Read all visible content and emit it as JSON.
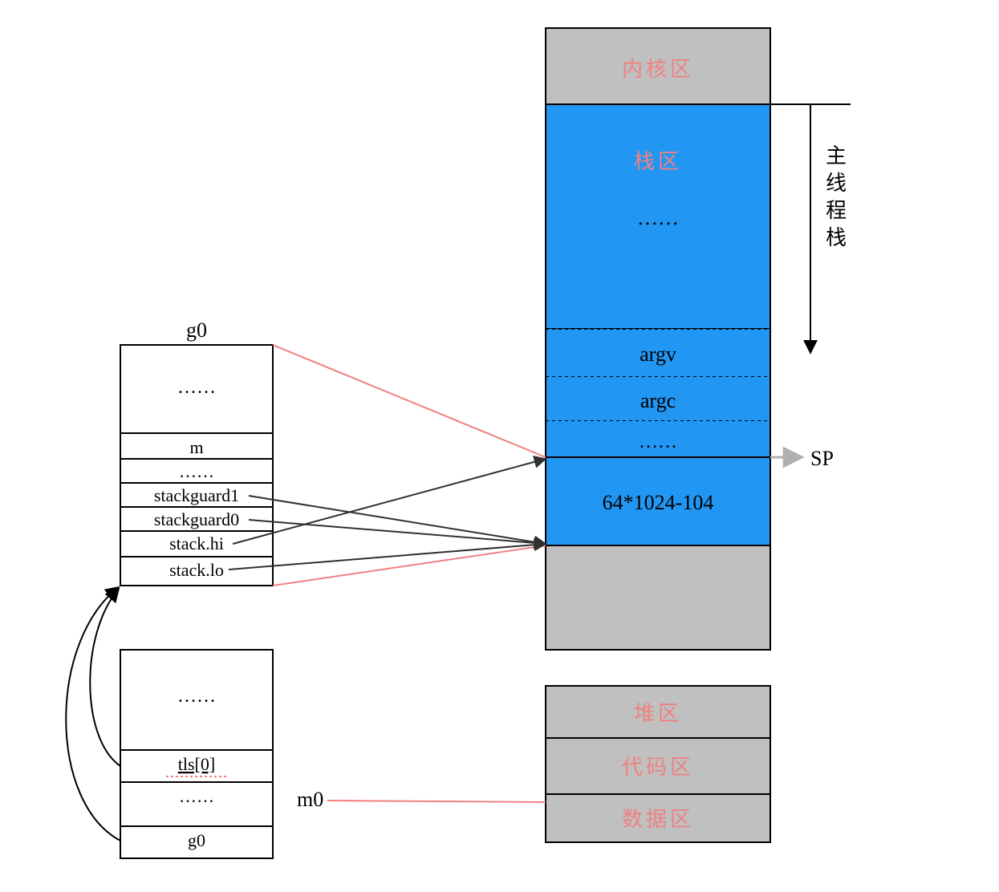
{
  "g0": {
    "title": "g0",
    "rows": [
      "……",
      "m",
      "……",
      "stackguard1",
      "stackguard0",
      "stack.hi",
      "stack.lo"
    ]
  },
  "m0": {
    "title": "m0",
    "rows": [
      "……",
      "tls[0]",
      "……",
      "g0"
    ]
  },
  "memory": {
    "kernel": "内核区",
    "stack": "栈区",
    "stack_dots": "……",
    "argv": "argv",
    "argc": "argc",
    "row_dots": "……",
    "size": "64*1024-104",
    "heap": "堆区",
    "code": "代码区",
    "data": "数据区"
  },
  "labels": {
    "sp": "SP",
    "main_stack": "主线程栈"
  },
  "colors": {
    "gray": "#c0c0c0",
    "blue": "#2196f3",
    "red": "#f08080",
    "black": "#000000",
    "dark": "#303030",
    "lightgray": "#b0b0b0"
  }
}
